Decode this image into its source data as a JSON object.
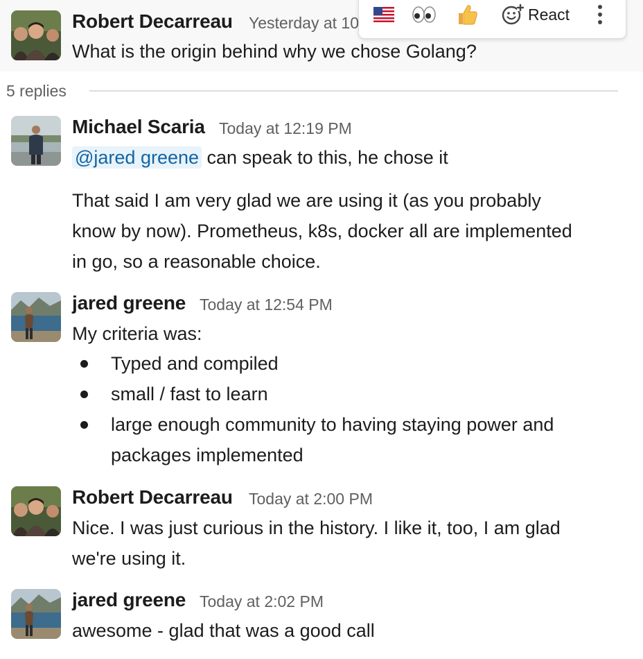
{
  "parent": {
    "author": "Robert Decarreau",
    "time": "Yesterday at 10",
    "text": "What is the origin behind why we chose Golang?"
  },
  "toolbar": {
    "react_label": "React",
    "items": [
      "flag-us-emoji",
      "eyes-emoji",
      "thumbs-up-emoji",
      "add-reaction-icon",
      "more-actions-icon"
    ]
  },
  "thread": {
    "replies_label": "5 replies"
  },
  "replies": [
    {
      "author": "Michael Scaria",
      "time": "Today at 12:19 PM",
      "mention": "@jared greene",
      "line1_rest": " can speak to this, he chose it",
      "para2_line1": "That said I am very glad we are using it (as you probably",
      "para2_line2": "know by now).  Prometheus, k8s, docker all are implemented",
      "para2_line3": "in go, so a reasonable choice."
    },
    {
      "author": "jared greene",
      "time": "Today at 12:54 PM",
      "intro": "My criteria was:",
      "bullets": [
        "Typed and compiled",
        "small / fast to learn",
        "large enough community to having staying power and",
        "packages implemented"
      ]
    },
    {
      "author": "Robert Decarreau",
      "time": "Today at 2:00 PM",
      "line1": "Nice. I was just curious in the history. I like it, too, I am glad",
      "line2": "we're using it."
    },
    {
      "author": "jared greene",
      "time": "Today at 2:02 PM",
      "line1": "awesome - glad that was a good call"
    }
  ]
}
